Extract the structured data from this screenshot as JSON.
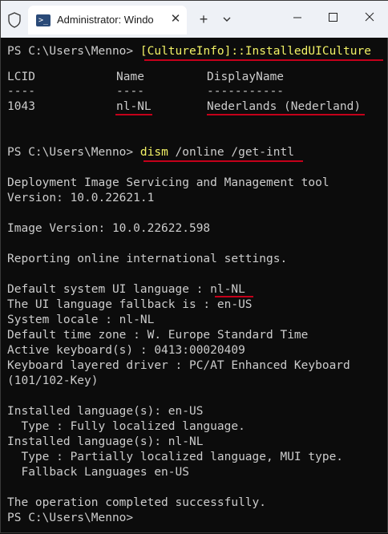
{
  "window": {
    "tab_title": "Administrator: Windo",
    "tab_icon_glyph": ">_",
    "close_tab_glyph": "✕",
    "new_tab_glyph": "+"
  },
  "colors": {
    "terminal_bg": "#0c0c0c",
    "text": "#cccccc",
    "command_highlight": "#f2f266",
    "annotation_underline": "#c4001a",
    "titlebar_bg": "#eef1f6"
  },
  "terminal": {
    "cmd1": {
      "prompt": "PS C:\\Users\\Menno> ",
      "command": "[CultureInfo]::InstalledUICulture"
    },
    "culture_table": {
      "headers": [
        "LCID",
        "Name",
        "DisplayName"
      ],
      "separators": [
        "----",
        "----",
        "-----------"
      ],
      "row": [
        "1043",
        "nl-NL",
        "Nederlands (Nederland)"
      ]
    },
    "cmd2": {
      "prompt": "PS C:\\Users\\Menno> ",
      "command": "dism",
      "args": " /online /get-intl"
    },
    "output": [
      "Deployment Image Servicing and Management tool",
      "Version: 10.0.22621.1",
      "Image Version: 10.0.22622.598",
      "Reporting online international settings.",
      "Default system UI language : nl-NL",
      "The UI language fallback is : en-US",
      "System locale : nl-NL",
      "Default time zone : W. Europe Standard Time",
      "Active keyboard(s) : 0413:00020409",
      "Keyboard layered driver : PC/AT Enhanced Keyboard",
      "(101/102-Key)",
      "Installed language(s): en-US",
      "  Type : Fully localized language.",
      "Installed language(s): nl-NL",
      "  Type : Partially localized language, MUI type.",
      "  Fallback Languages en-US",
      "The operation completed successfully.",
      "PS C:\\Users\\Menno>"
    ]
  }
}
